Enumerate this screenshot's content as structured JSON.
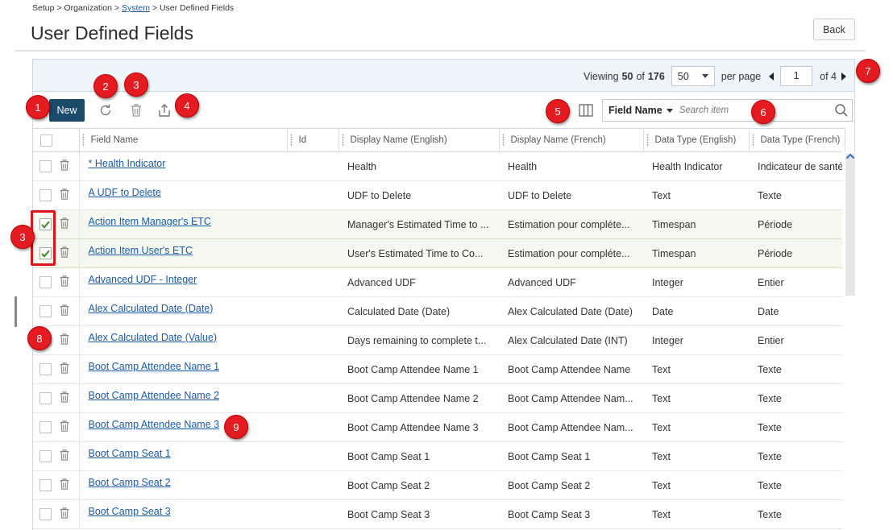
{
  "breadcrumb": {
    "setup": "Setup",
    "sep1": ">",
    "organization": "Organization",
    "sep2": ">",
    "system": "System",
    "sep3": ">",
    "current": "User Defined Fields"
  },
  "page": {
    "title": "User Defined Fields",
    "back_label": "Back"
  },
  "pager": {
    "viewing_label": "Viewing",
    "shown": "50",
    "of_label": "of",
    "total": "176",
    "per_page_value": "50",
    "per_page_label": "per page",
    "page": "1",
    "of_pages": "of 4"
  },
  "toolbar": {
    "new_label": "New",
    "search_field": "Field Name",
    "search_placeholder": "Search item"
  },
  "columns": [
    "Field Name",
    "Id",
    "Display Name (English)",
    "Display Name (French)",
    "Data Type (English)",
    "Data Type (French)"
  ],
  "rows": [
    {
      "name": "* Health Indicator",
      "id": "",
      "display_en": "Health",
      "display_fr": "Health",
      "type_en": "Health Indicator",
      "type_fr": "Indicateur de santé",
      "checked": false
    },
    {
      "name": "A UDF to Delete",
      "id": "",
      "display_en": "UDF to Delete",
      "display_fr": "UDF to Delete",
      "type_en": "Text",
      "type_fr": "Texte",
      "checked": false
    },
    {
      "name": "Action Item Manager's ETC",
      "id": "",
      "display_en": "Manager's Estimated Time to ...",
      "display_fr": "Estimation pour compléte...",
      "type_en": "Timespan",
      "type_fr": "Période",
      "checked": true
    },
    {
      "name": "Action Item User's ETC",
      "id": "",
      "display_en": "User's Estimated Time to Co...",
      "display_fr": "Estimation pour compléte...",
      "type_en": "Timespan",
      "type_fr": "Période",
      "checked": true
    },
    {
      "name": "Advanced UDF - Integer",
      "id": "",
      "display_en": "Advanced UDF",
      "display_fr": "Advanced UDF",
      "type_en": "Integer",
      "type_fr": "Entier",
      "checked": false
    },
    {
      "name": "Alex Calculated Date (Date)",
      "id": "",
      "display_en": "Calculated Date (Date)",
      "display_fr": "Alex Calculated Date (Date)",
      "type_en": "Date",
      "type_fr": "Date",
      "checked": false
    },
    {
      "name": "Alex Calculated Date (Value)",
      "id": "",
      "display_en": "Days remaining to complete t...",
      "display_fr": "Alex Calculated Date (INT)",
      "type_en": "Integer",
      "type_fr": "Entier",
      "checked": false
    },
    {
      "name": "Boot Camp Attendee Name 1",
      "id": "",
      "display_en": "Boot Camp Attendee Name 1",
      "display_fr": "Boot Camp Attendee Name",
      "type_en": "Text",
      "type_fr": "Texte",
      "checked": false
    },
    {
      "name": "Boot Camp Attendee Name 2",
      "id": "",
      "display_en": "Boot Camp Attendee Name 2",
      "display_fr": "Boot Camp Attendee Nam...",
      "type_en": "Text",
      "type_fr": "Texte",
      "checked": false
    },
    {
      "name": "Boot Camp Attendee Name 3",
      "id": "",
      "display_en": "Boot Camp Attendee Name 3",
      "display_fr": "Boot Camp Attendee Nam...",
      "type_en": "Text",
      "type_fr": "Texte",
      "checked": false
    },
    {
      "name": "Boot Camp Seat 1",
      "id": "",
      "display_en": "Boot Camp Seat 1",
      "display_fr": "Boot Camp Seat 1",
      "type_en": "Text",
      "type_fr": "Texte",
      "checked": false
    },
    {
      "name": "Boot Camp Seat 2",
      "id": "",
      "display_en": "Boot Camp Seat 2",
      "display_fr": "Boot Camp Seat 2",
      "type_en": "Text",
      "type_fr": "Texte",
      "checked": false
    },
    {
      "name": "Boot Camp Seat 3",
      "id": "",
      "display_en": "Boot Camp Seat 3",
      "display_fr": "Boot Camp Seat 3",
      "type_en": "Text",
      "type_fr": "Texte",
      "checked": false
    }
  ],
  "callouts": [
    "1",
    "2",
    "3",
    "4",
    "5",
    "6",
    "7",
    "8",
    "9",
    "3"
  ],
  "colors": {
    "accent": "#1c4a6b",
    "link": "#1a5aa8",
    "callout": "#e41b20",
    "header_band": "#eef5fb",
    "selected_row": "#f5f8ee",
    "check": "#3a8a2a"
  }
}
